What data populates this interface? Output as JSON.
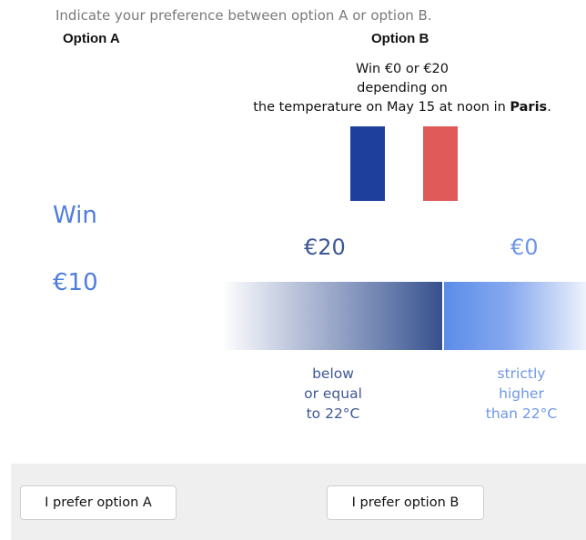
{
  "instruction": "Indicate your preference between option A or option B.",
  "option_a": {
    "title": "Option A",
    "win_label": "Win",
    "win_amount": "€10"
  },
  "option_b": {
    "title": "Option B",
    "description_line1": "Win €0 or €20",
    "description_line2": "depending on",
    "description_line3_prefix": "the temperature on May 15 at noon in ",
    "description_city": "Paris",
    "description_line3_suffix": ".",
    "flag_colors": {
      "blue": "#1e3f9c",
      "red": "#e05a5a"
    },
    "outcomes": [
      {
        "amount": "€20",
        "condition": [
          "below",
          "or equal",
          "to 22°C"
        ],
        "color": "#3d5796"
      },
      {
        "amount": "€0",
        "condition": [
          "strictly",
          "higher",
          "than 22°C"
        ],
        "color": "#6e96e8"
      }
    ]
  },
  "buttons": {
    "prefer_a": "I prefer option A",
    "prefer_b": "I prefer option B"
  },
  "colors": {
    "accent": "#4f7ddd",
    "footer_bg": "#efefef"
  }
}
